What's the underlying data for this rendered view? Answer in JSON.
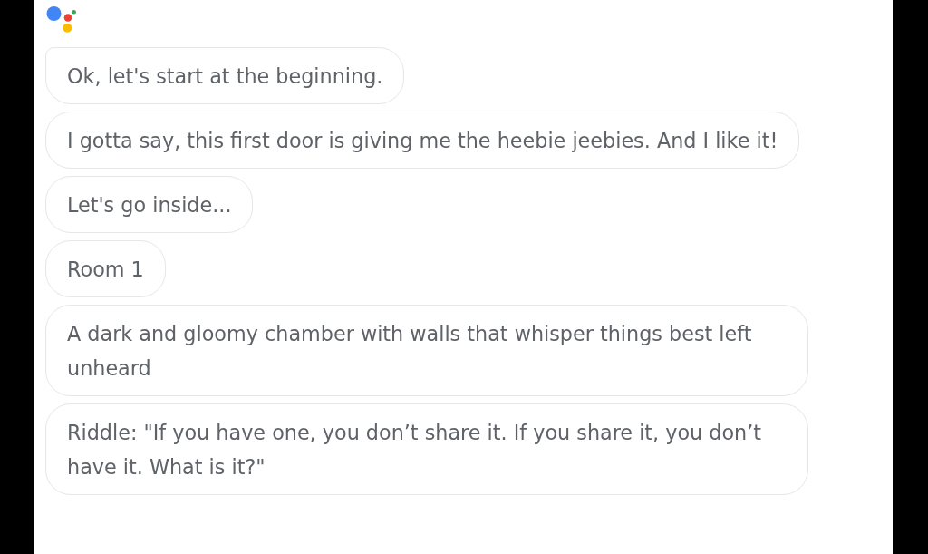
{
  "messages": [
    {
      "text": "Ok, let's start at the beginning."
    },
    {
      "text": "I gotta say, this first door is giving me the heebie jeebies. And I like it!"
    },
    {
      "text": "Let's go inside..."
    },
    {
      "text": "Room 1"
    },
    {
      "text": "A dark and gloomy chamber with walls that whisper things best left unheard"
    },
    {
      "text": "Riddle: \"If you have one, you don’t share it. If you share it, you don’t have it. What is it?\""
    }
  ]
}
